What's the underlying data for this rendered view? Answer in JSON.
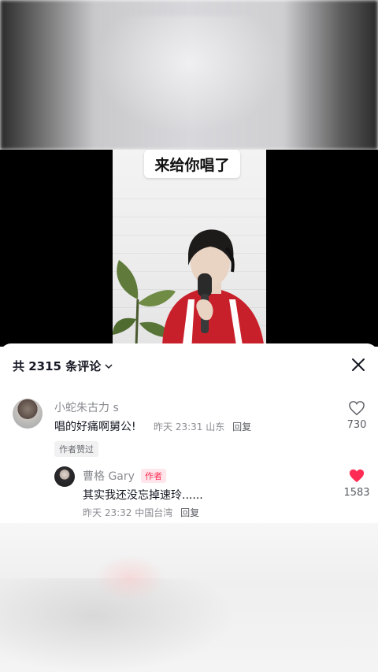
{
  "video": {
    "caption": "来给你唱了"
  },
  "comments_panel": {
    "title": "共 2315 条评论",
    "comments": [
      {
        "username": "小蛇朱古力 s",
        "text": "唱的好痛啊舅公!",
        "time": "昨天 23:31",
        "location": "山东",
        "reply_label": "回复",
        "likes": "730",
        "liked_by_author_label": "作者赞过"
      }
    ],
    "reply": {
      "username": "曹格 Gary",
      "author_label": "作者",
      "text": "其实我还没忘掉速玲......",
      "time": "昨天 23:32",
      "location": "中国台湾",
      "reply_label": "回复",
      "likes": "1583"
    }
  },
  "colors": {
    "accent_red": "#fe2c55",
    "text_primary": "#161823",
    "text_secondary": "#8a8b91"
  }
}
